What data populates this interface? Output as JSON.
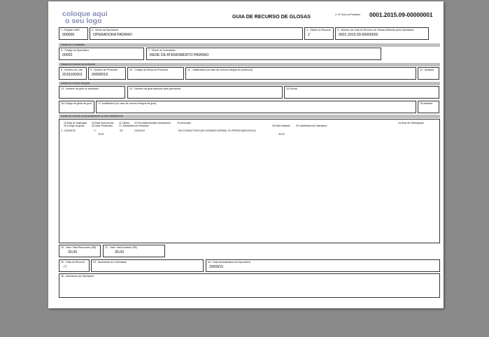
{
  "header": {
    "logo_line1": "coloque aqui",
    "logo_line2": "o seu logo",
    "title": "GUIA DE RECURSO DE GLOSAS",
    "guia_prestador_label": "2- Nº Guia no Prestador",
    "guia_prestador": "0001.2015.09-00000001"
  },
  "fields": {
    "f1": {
      "label": "1 - Registro ANS",
      "value": "000000"
    },
    "f3": {
      "label": "3 - Nome da Operadora",
      "value": "OPERADORA PADRAO"
    },
    "f4": {
      "label": "4 - Objeto do Recurso",
      "value": "2"
    },
    "f5": {
      "label": "5 - Número da Guia de Recurso de Glosas Atribuído pela Operadora",
      "value": "0001.2015.09-00000002"
    },
    "f6": {
      "label": "6 - Código na Operadora",
      "value": "00002"
    },
    "f7": {
      "label": "7 - Nome do Contratado",
      "value": "REDE DE ATENDIMENTO PADRAO"
    },
    "f8": {
      "label": "8 - Número do Lote",
      "value": "2015100001"
    },
    "f9": {
      "label": "9 - Número do Protocolo",
      "value": "00000018"
    },
    "f10": {
      "label": "10 - Código da Glosa do Protocolo",
      "value": ""
    },
    "f11": {
      "label": "11 - Justificativa (no caso de recurso integral do protocolo)",
      "value": ""
    },
    "f12": {
      "label": "12 - Acatado",
      "value": ""
    },
    "f13": {
      "label": "13 - Número da guia no prestador",
      "value": ""
    },
    "f14": {
      "label": "14 - Número da guia atribuído pela operadora",
      "value": ""
    },
    "f15": {
      "label": "15-Senha",
      "value": ""
    },
    "f16": {
      "label": "16-Código da glosa da guia",
      "value": ""
    },
    "f17": {
      "label": "17-Justificativa (no caso de recurso integral da guia)",
      "value": ""
    },
    "f18": {
      "label": "18-Acatado",
      "value": ""
    },
    "f30": {
      "label": "30 - Valor Total Recursado (R$)",
      "value": "30,00"
    },
    "f31": {
      "label": "31 - Valor Total Acatado (R$)",
      "value": "30,00"
    },
    "f32": {
      "label": "32 - Data do Recurso",
      "value": "/ /"
    },
    "f33": {
      "label": "33 - Assinatura do Contratado",
      "value": ""
    },
    "f34": {
      "label": "34 - Data da Assinatura da Operadora",
      "value": "29/09/15"
    },
    "f35": {
      "label": "35 - Assinatura da Operadora",
      "value": ""
    }
  },
  "sections": {
    "contratado": "Dados do Contratado",
    "protocolo": "Dados do recurso do protocolo",
    "guia": "Dados do recurso da guia",
    "procedimento": "Dados do recurso do procedimento ou item assistencial"
  },
  "proc_headers": {
    "h19": "19-Data de realização",
    "h20": "20-Data final período",
    "h21": "21-Tabela",
    "h22": "22-Procedimento/item assistencial",
    "h23": "23-Descrição",
    "h24": "24-Grau de Participação",
    "h25": "25-Código da glosa",
    "h26": "26-Valor Recursado",
    "h27": "27-Justificativa do Prestador",
    "h28": "28-Valor Acatado",
    "h29": "29-Justificativa da Operadora"
  },
  "proc_row": {
    "index": "1",
    "data_realizacao": "23/09/15",
    "data_final": "/ /",
    "tabela": "23",
    "procedimento": "10101012",
    "descricao": "EM CONSULTORIO (NO HORARIO NORMAL OU PREESTABELECIDO)",
    "valor_recursado": "30,00",
    "valor_acatado": "30,00"
  }
}
